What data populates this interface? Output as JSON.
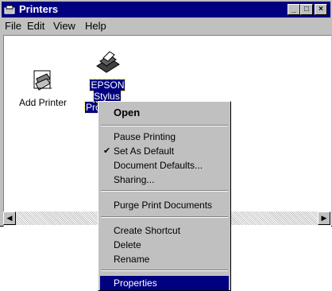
{
  "window": {
    "title": "Printers",
    "minimize": "_",
    "maximize": "□",
    "close": "×"
  },
  "menubar": [
    "File",
    "Edit",
    "View",
    "Help"
  ],
  "icons": [
    {
      "label": "Add Printer",
      "icon": "add-printer-icon"
    },
    {
      "label_line1": "EPSON Stylus",
      "label_line2": "Pro XXXX",
      "icon": "printer-icon",
      "selected": true
    }
  ],
  "context_menu": {
    "items": [
      {
        "label": "Open",
        "bold": true
      },
      {
        "label": "Pause Printing"
      },
      {
        "label": "Set As Default",
        "checked": true
      },
      {
        "label": "Document Defaults..."
      },
      {
        "label": "Sharing..."
      },
      {
        "label": "Purge Print Documents"
      },
      {
        "label": "Create Shortcut"
      },
      {
        "label": "Delete"
      },
      {
        "label": "Rename"
      },
      {
        "label": "Properties",
        "highlighted": true
      }
    ]
  },
  "scrollbar": {
    "left_arrow": "◀",
    "right_arrow": "▶"
  },
  "colors": {
    "titlebar": "#000080",
    "face": "#c0c0c0",
    "highlight": "#000080"
  }
}
